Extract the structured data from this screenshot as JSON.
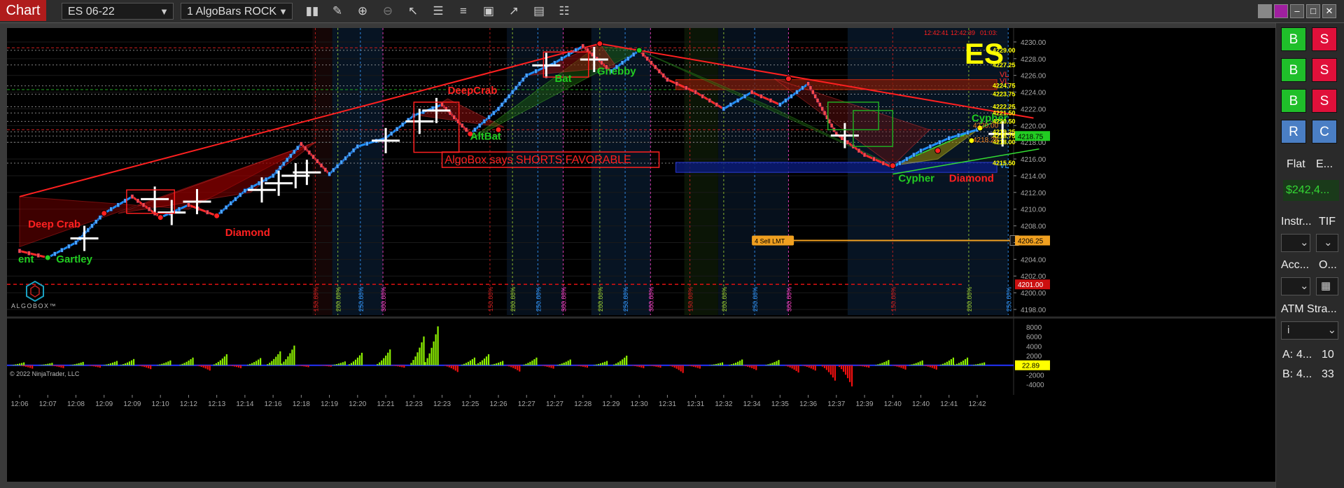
{
  "toolbar": {
    "tab_label": "Chart",
    "instrument": "ES 06-22",
    "bars_type": "1 AlgoBars ROCK",
    "icons": [
      "bar-chart-icon",
      "pencil-icon",
      "zoom-in-icon",
      "zoom-out-icon",
      "pointer-icon",
      "properties-icon",
      "strategies-icon",
      "templates-icon",
      "drawing-tools-icon",
      "indicators-icon",
      "data-box-icon"
    ]
  },
  "chart_data": {
    "type": "candlestick",
    "symbol_badge": "ES",
    "price_axis": {
      "ylim": [
        4198.0,
        4231.0
      ],
      "ticks": [
        "4230.00",
        "4228.00",
        "4226.00",
        "4224.00",
        "4222.00",
        "4220.00",
        "4218.00",
        "4216.00",
        "4214.00",
        "4212.00",
        "4210.00",
        "4208.00",
        "4206.00",
        "4204.00",
        "4202.00",
        "4200.00",
        "4198.00"
      ]
    },
    "time_axis": {
      "ticks": [
        "12:06",
        "12:07",
        "12:08",
        "12:09",
        "12:09",
        "12:10",
        "12:12",
        "12:13",
        "12:14",
        "12:16",
        "12:18",
        "12:19",
        "12:20",
        "12:21",
        "12:23",
        "12:23",
        "12:25",
        "12:26",
        "12:27",
        "12:27",
        "12:28",
        "12:29",
        "12:30",
        "12:31",
        "12:31",
        "12:32",
        "12:34",
        "12:35",
        "12:36",
        "12:37",
        "12:39",
        "12:40",
        "12:40",
        "12:41",
        "12:42"
      ]
    },
    "price_path": [
      {
        "t": 0,
        "p": 4205.0
      },
      {
        "t": 1,
        "p": 4204.2
      },
      {
        "t": 2,
        "p": 4206.0
      },
      {
        "t": 3,
        "p": 4209.5
      },
      {
        "t": 4,
        "p": 4211.5
      },
      {
        "t": 5,
        "p": 4209.0
      },
      {
        "t": 6,
        "p": 4210.5
      },
      {
        "t": 7,
        "p": 4209.2
      },
      {
        "t": 8,
        "p": 4212.2
      },
      {
        "t": 9,
        "p": 4214.0
      },
      {
        "t": 10,
        "p": 4217.8
      },
      {
        "t": 11,
        "p": 4214.2
      },
      {
        "t": 12,
        "p": 4217.5
      },
      {
        "t": 13,
        "p": 4218.5
      },
      {
        "t": 14,
        "p": 4221.2
      },
      {
        "t": 15,
        "p": 4222.5
      },
      {
        "t": 16,
        "p": 4219.0
      },
      {
        "t": 17,
        "p": 4222.0
      },
      {
        "t": 18,
        "p": 4226.0
      },
      {
        "t": 19,
        "p": 4227.5
      },
      {
        "t": 20,
        "p": 4229.5
      },
      {
        "t": 21,
        "p": 4226.5
      },
      {
        "t": 22,
        "p": 4229.0
      },
      {
        "t": 23,
        "p": 4225.5
      },
      {
        "t": 24,
        "p": 4224.0
      },
      {
        "t": 25,
        "p": 4222.0
      },
      {
        "t": 26,
        "p": 4224.0
      },
      {
        "t": 27,
        "p": 4222.5
      },
      {
        "t": 28,
        "p": 4225.0
      },
      {
        "t": 29,
        "p": 4219.0
      },
      {
        "t": 30,
        "p": 4216.5
      },
      {
        "t": 31,
        "p": 4215.0
      },
      {
        "t": 32,
        "p": 4217.0
      },
      {
        "t": 33,
        "p": 4218.5
      },
      {
        "t": 34,
        "p": 4219.5
      }
    ],
    "level_labels": [
      {
        "price": 4229.0,
        "label": "4229.00",
        "color": "#ffff00"
      },
      {
        "price": 4227.25,
        "label": "4227.25",
        "color": "#ffff00"
      },
      {
        "price": 4224.75,
        "label": "4224.75",
        "color": "#ffff00"
      },
      {
        "price": 4223.75,
        "label": "4223.75",
        "color": "#ffff00"
      },
      {
        "price": 4222.25,
        "label": "4222.25",
        "color": "#ffff00"
      },
      {
        "price": 4221.5,
        "label": "4221.50",
        "color": "#ffff00"
      },
      {
        "price": 4220.5,
        "label": "4220.50",
        "color": "#ffff00"
      },
      {
        "price": 4219.25,
        "label": "4219.25",
        "color": "#ffff00"
      },
      {
        "price": 4218.75,
        "label": "4218.75",
        "color": "#ffff00"
      },
      {
        "price": 4218.0,
        "label": "4218.00",
        "color": "#ffff00"
      },
      {
        "price": 4215.5,
        "label": "4215.50",
        "color": "#ffff00"
      }
    ],
    "orange_labels": [
      {
        "price": 4220.0,
        "label": "4220.00"
      },
      {
        "price": 4218.25,
        "label": "4218.25"
      }
    ],
    "current_price": {
      "price": 4218.75,
      "label": "4218.75",
      "color": "#22cc22"
    },
    "sell_order": {
      "price": 4206.25,
      "label": "4206.25",
      "tag": "4 Sell LMT",
      "color": "#f0a020"
    },
    "red_level": {
      "price": 4201.0,
      "label": "4201.00"
    },
    "pattern_labels": [
      {
        "text": "Deep Crab",
        "t": 0.3,
        "p": 4207.8,
        "color": "#ff2020"
      },
      {
        "text": "Gartley",
        "t": 1.3,
        "p": 4203.6,
        "color": "#22cc22"
      },
      {
        "text": "ent",
        "t": -0.05,
        "p": 4203.6,
        "color": "#22cc22"
      },
      {
        "text": "Diamond",
        "t": 7.3,
        "p": 4206.8,
        "color": "#ff2020"
      },
      {
        "text": "DeepCrab",
        "t": 15.2,
        "p": 4223.8,
        "color": "#ff2020"
      },
      {
        "text": "AltBat",
        "t": 16.0,
        "p": 4218.3,
        "color": "#22cc22"
      },
      {
        "text": "Bat",
        "t": 19.0,
        "p": 4225.2,
        "color": "#22cc22"
      },
      {
        "text": "Gnebby",
        "t": 20.5,
        "p": 4226.1,
        "color": "#22cc22"
      },
      {
        "text": "Cypher",
        "t": 31.2,
        "p": 4213.3,
        "color": "#22cc22"
      },
      {
        "text": "Diamond",
        "t": 33.0,
        "p": 4213.3,
        "color": "#ff2020"
      },
      {
        "text": "Cypher",
        "t": 33.8,
        "p": 4220.5,
        "color": "#22cc22"
      }
    ],
    "vertical_line_labels": [
      {
        "t": 10.5,
        "text": "150.00%",
        "color": "#cc2020"
      },
      {
        "t": 11.3,
        "text": "200.00%",
        "color": "#9acd32"
      },
      {
        "t": 12.1,
        "text": "250.00%",
        "color": "#3399ff"
      },
      {
        "t": 12.9,
        "text": "300.00%",
        "color": "#ff44cc"
      },
      {
        "t": 16.7,
        "text": "150.00%",
        "color": "#cc2020"
      },
      {
        "t": 17.5,
        "text": "200.00%",
        "color": "#9acd32"
      },
      {
        "t": 18.4,
        "text": "250.00%",
        "color": "#3399ff"
      },
      {
        "t": 19.3,
        "text": "300.00%",
        "color": "#ff44cc"
      },
      {
        "t": 20.6,
        "text": "200.00%",
        "color": "#9acd32"
      },
      {
        "t": 21.5,
        "text": "250.00%",
        "color": "#3399ff"
      },
      {
        "t": 22.4,
        "text": "300.00%",
        "color": "#ff44cc"
      },
      {
        "t": 23.8,
        "text": "150.00%",
        "color": "#cc2020"
      },
      {
        "t": 25.0,
        "text": "200.00%",
        "color": "#9acd32"
      },
      {
        "t": 26.1,
        "text": "250.00%",
        "color": "#3399ff"
      },
      {
        "t": 27.3,
        "text": "300.00%",
        "color": "#ff44cc"
      },
      {
        "t": 31.0,
        "text": "150.00%",
        "color": "#cc2020"
      },
      {
        "t": 33.7,
        "text": "200.00%",
        "color": "#9acd32"
      },
      {
        "t": 35.1,
        "text": "250.00%",
        "color": "#3399ff"
      }
    ],
    "banner": "AlgoBox says SHORTS FAVORABLE",
    "timestamps": [
      "12:42:41",
      "12:42:39",
      "01:03:"
    ],
    "side_marks": [
      "VL",
      "VL",
      "VL"
    ],
    "logo_text": "ALGOBOX™",
    "copyright": "© 2022 NinjaTrader, LLC",
    "volume_panel": {
      "ticks": [
        "8000",
        "6000",
        "4000",
        "2000",
        "0",
        "-2000",
        "-4000"
      ],
      "ylim": [
        -5000,
        9000
      ],
      "current_value": "22.89",
      "current_value_color": "#ffff00",
      "bars": [
        {
          "t": 0.2,
          "v": 600
        },
        {
          "t": 0.5,
          "v": -700
        },
        {
          "t": 1.2,
          "v": 500
        },
        {
          "t": 1.6,
          "v": -600
        },
        {
          "t": 2.3,
          "v": 700
        },
        {
          "t": 2.9,
          "v": -500
        },
        {
          "t": 3.5,
          "v": 900
        },
        {
          "t": 4.1,
          "v": 1300
        },
        {
          "t": 4.7,
          "v": -800
        },
        {
          "t": 5.4,
          "v": 1000
        },
        {
          "t": 6.2,
          "v": 1600
        },
        {
          "t": 6.8,
          "v": -1100
        },
        {
          "t": 7.4,
          "v": 2300
        },
        {
          "t": 7.9,
          "v": -600
        },
        {
          "t": 8.6,
          "v": 1500
        },
        {
          "t": 9.3,
          "v": 2900
        },
        {
          "t": 9.8,
          "v": 4100
        },
        {
          "t": 10.3,
          "v": -400
        },
        {
          "t": 11.1,
          "v": -300
        },
        {
          "t": 11.6,
          "v": 800
        },
        {
          "t": 12.2,
          "v": 2600
        },
        {
          "t": 13.2,
          "v": 3300
        },
        {
          "t": 13.7,
          "v": -500
        },
        {
          "t": 14.4,
          "v": 6000
        },
        {
          "t": 14.9,
          "v": 8100
        },
        {
          "t": 15.6,
          "v": -1400
        },
        {
          "t": 16.2,
          "v": 1600
        },
        {
          "t": 16.7,
          "v": 2300
        },
        {
          "t": 17.2,
          "v": 900
        },
        {
          "t": 17.8,
          "v": -1300
        },
        {
          "t": 18.4,
          "v": 1600
        },
        {
          "t": 19.0,
          "v": -700
        },
        {
          "t": 19.6,
          "v": 1200
        },
        {
          "t": 20.2,
          "v": -500
        },
        {
          "t": 20.9,
          "v": 900
        },
        {
          "t": 21.6,
          "v": 2000
        },
        {
          "t": 22.2,
          "v": -600
        },
        {
          "t": 22.8,
          "v": -500
        },
        {
          "t": 23.6,
          "v": -1600
        },
        {
          "t": 24.2,
          "v": -700
        },
        {
          "t": 25.0,
          "v": 600
        },
        {
          "t": 25.7,
          "v": 1200
        },
        {
          "t": 26.2,
          "v": -1000
        },
        {
          "t": 27.0,
          "v": 1100
        },
        {
          "t": 27.7,
          "v": -1500
        },
        {
          "t": 28.3,
          "v": -1100
        },
        {
          "t": 29.0,
          "v": -3200
        },
        {
          "t": 29.6,
          "v": -4400
        },
        {
          "t": 30.2,
          "v": -500
        },
        {
          "t": 30.9,
          "v": 1100
        },
        {
          "t": 31.5,
          "v": -900
        },
        {
          "t": 32.1,
          "v": 1000
        },
        {
          "t": 32.6,
          "v": -900
        },
        {
          "t": 33.2,
          "v": 1600
        },
        {
          "t": 33.7,
          "v": 1600
        },
        {
          "t": 34.3,
          "v": 600
        }
      ]
    }
  },
  "right_panel": {
    "buy_label": "B",
    "sell_label": "S",
    "r_label": "R",
    "c_label": "C",
    "position_status": "Flat",
    "position_col2": "E...",
    "pnl": "$242,4...",
    "instr_label": "Instr...",
    "tif_label": "TIF",
    "acc_label": "Acc...",
    "o_label": "O...",
    "atm_label": "ATM Stra...",
    "atm_value": "i",
    "ask_label": "A:",
    "ask_price": "4...",
    "ask_size": "10",
    "bid_label": "B:",
    "bid_price": "4...",
    "bid_size": "33"
  }
}
